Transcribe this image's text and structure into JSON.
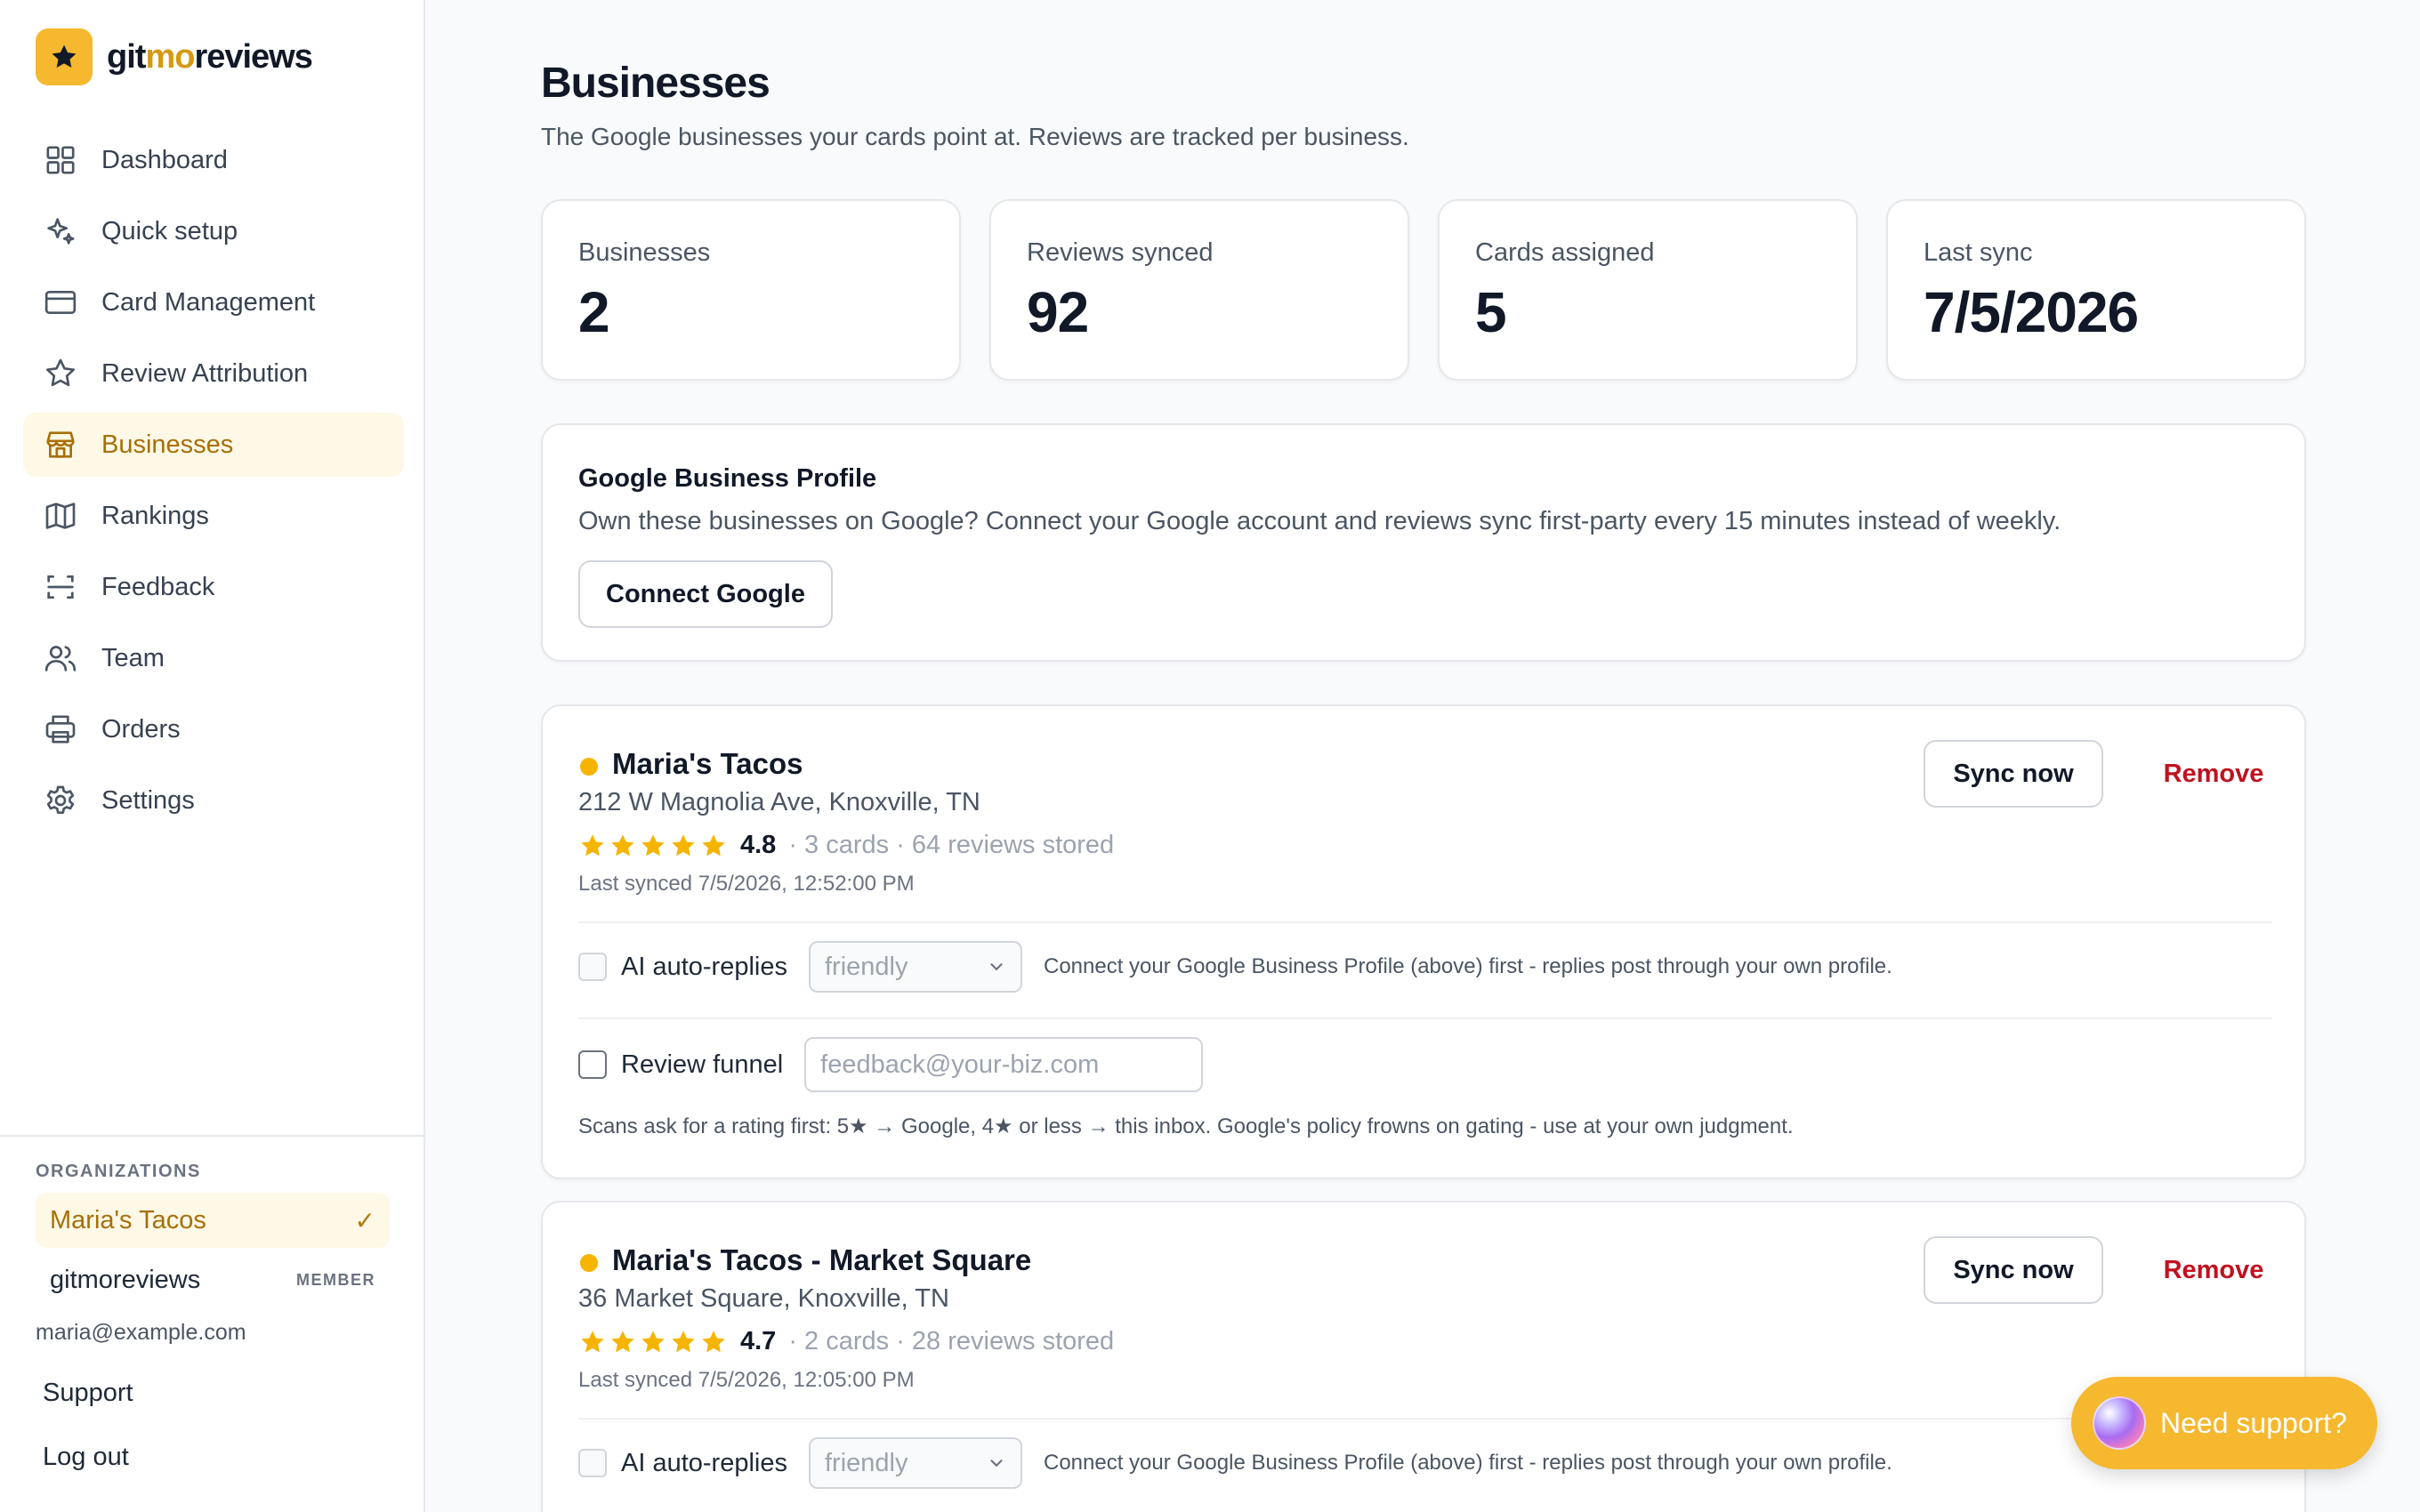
{
  "brand": {
    "name_start": "git",
    "name_accent": "mo",
    "name_end": "reviews"
  },
  "colors": {
    "accent": "#f5b82e",
    "active_text": "#a76f07",
    "danger": "#c1121f",
    "star": "#f5b400"
  },
  "nav": {
    "items": [
      {
        "label": "Dashboard",
        "icon": "dashboard-grid-icon"
      },
      {
        "label": "Quick setup",
        "icon": "sparkles-icon"
      },
      {
        "label": "Card Management",
        "icon": "credit-card-icon"
      },
      {
        "label": "Review Attribution",
        "icon": "star-icon"
      },
      {
        "label": "Businesses",
        "icon": "storefront-icon",
        "active": true
      },
      {
        "label": "Rankings",
        "icon": "map-icon"
      },
      {
        "label": "Feedback",
        "icon": "scan-icon"
      },
      {
        "label": "Team",
        "icon": "users-icon"
      },
      {
        "label": "Orders",
        "icon": "printer-icon"
      },
      {
        "label": "Settings",
        "icon": "gear-icon"
      }
    ]
  },
  "organizations": {
    "heading": "ORGANIZATIONS",
    "items": [
      {
        "name": "Maria's Tacos",
        "selected": true,
        "mark": "✓"
      },
      {
        "name": "gitmoreviews",
        "role": "MEMBER"
      }
    ],
    "user_email": "maria@example.com"
  },
  "footer_links": {
    "support": "Support",
    "logout": "Log out"
  },
  "page": {
    "title": "Businesses",
    "subtitle": "The Google businesses your cards point at. Reviews are tracked per business."
  },
  "stats": [
    {
      "label": "Businesses",
      "value": "2"
    },
    {
      "label": "Reviews synced",
      "value": "92"
    },
    {
      "label": "Cards assigned",
      "value": "5"
    },
    {
      "label": "Last sync",
      "value": "7/5/2026"
    }
  ],
  "gbp": {
    "title": "Google Business Profile",
    "description": "Own these businesses on Google? Connect your Google account and reviews sync first-party every 15 minutes instead of weekly.",
    "button": "Connect Google"
  },
  "businesses": [
    {
      "name": "Maria's Tacos",
      "address": "212 W Magnolia Ave, Knoxville, TN",
      "stars": 5,
      "rating": "4.8",
      "meta": "· 3 cards · 64 reviews stored",
      "last_synced": "Last synced 7/5/2026, 12:52:00 PM",
      "sync_label": "Sync now",
      "remove_label": "Remove",
      "ai_label": "AI auto-replies",
      "tone": "friendly",
      "ai_hint": "Connect your Google Business Profile (above) first - replies post through your own profile.",
      "funnel_label": "Review funnel",
      "funnel_placeholder": "feedback@your-biz.com",
      "funnel_note": "Scans ask for a rating first: 5★ → Google, 4★ or less → this inbox. Google's policy frowns on gating - use at your own judgment."
    },
    {
      "name": "Maria's Tacos - Market Square",
      "address": "36 Market Square, Knoxville, TN",
      "stars": 5,
      "rating": "4.7",
      "meta": "· 2 cards · 28 reviews stored",
      "last_synced": "Last synced 7/5/2026, 12:05:00 PM",
      "sync_label": "Sync now",
      "remove_label": "Remove",
      "ai_label": "AI auto-replies",
      "tone": "friendly",
      "ai_hint": "Connect your Google Business Profile (above) first - replies post through your own profile."
    }
  ],
  "support_widget": {
    "label": "Need support?"
  }
}
